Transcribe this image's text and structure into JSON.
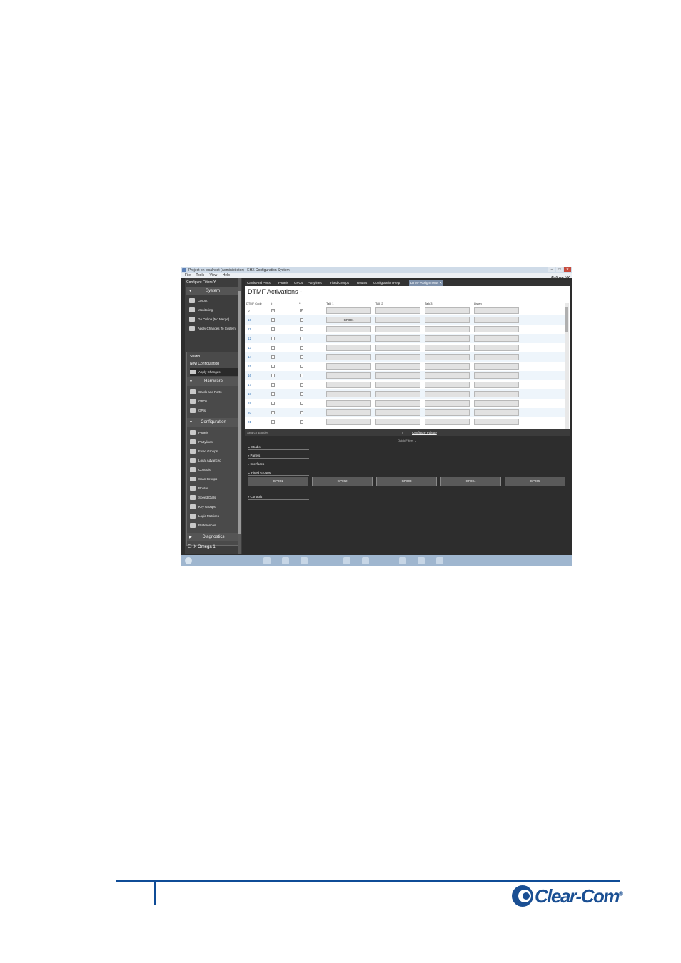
{
  "window": {
    "title": "Project on localhost (Administrator) - EHX Configuration System",
    "menu": [
      "File",
      "Tools",
      "View",
      "Help"
    ],
    "brand": "Eclipse HX",
    "controls": [
      "–",
      "□",
      "✕"
    ]
  },
  "sidebar": {
    "configure_filters": "Configure Filters",
    "system_header": "System",
    "system_items": [
      "Layout",
      "Monitoring",
      "Go Online (No Merge)",
      "Apply Changes To System"
    ],
    "studio_label": "Studio",
    "new_configuration": "New Configuration",
    "apply_changes": "Apply Changes",
    "hardware_header": "Hardware",
    "hardware_items": [
      "Cards and Ports",
      "GPOs",
      "GPIs"
    ],
    "configuration_header": "Configuration",
    "configuration_items": [
      "Panels",
      "Partylines",
      "Fixed Groups",
      "Local Advanced",
      "Controls",
      "Scan Groups",
      "Routes",
      "Speed Dials",
      "Key Groups",
      "Logic Matrices",
      "Preferences"
    ],
    "diagnostics_header": "Diagnostics",
    "matrix_name": "EHX Omega 1"
  },
  "tabs": [
    "Cards And Ports",
    "Panels",
    "GPOs",
    "Partylines",
    "Fixed Groups",
    "Routes",
    "Configuration Help",
    "DTMF Assignments"
  ],
  "active_tab": "DTMF Assignments",
  "dtmf": {
    "title": "DTMF Activations -",
    "columns": [
      "DTMF Code",
      "#",
      "*",
      "Talk 1",
      "Talk 2",
      "Talk 3",
      "Listen"
    ],
    "rows": [
      {
        "code": "0",
        "hash": true,
        "star": true,
        "talk1": "",
        "talk2": "",
        "talk3": "",
        "listen": ""
      },
      {
        "code": "10",
        "hash": false,
        "star": false,
        "talk1": "GP001",
        "talk2": "",
        "talk3": "",
        "listen": ""
      },
      {
        "code": "11",
        "hash": false,
        "star": false,
        "talk1": "",
        "talk2": "",
        "talk3": "",
        "listen": ""
      },
      {
        "code": "12",
        "hash": false,
        "star": false,
        "talk1": "",
        "talk2": "",
        "talk3": "",
        "listen": ""
      },
      {
        "code": "13",
        "hash": false,
        "star": false,
        "talk1": "",
        "talk2": "",
        "talk3": "",
        "listen": ""
      },
      {
        "code": "14",
        "hash": false,
        "star": false,
        "talk1": "",
        "talk2": "",
        "talk3": "",
        "listen": ""
      },
      {
        "code": "15",
        "hash": false,
        "star": false,
        "talk1": "",
        "talk2": "",
        "talk3": "",
        "listen": ""
      },
      {
        "code": "16",
        "hash": false,
        "star": false,
        "talk1": "",
        "talk2": "",
        "talk3": "",
        "listen": ""
      },
      {
        "code": "17",
        "hash": false,
        "star": false,
        "talk1": "",
        "talk2": "",
        "talk3": "",
        "listen": ""
      },
      {
        "code": "18",
        "hash": false,
        "star": false,
        "talk1": "",
        "talk2": "",
        "talk3": "",
        "listen": ""
      },
      {
        "code": "19",
        "hash": false,
        "star": false,
        "talk1": "",
        "talk2": "",
        "talk3": "",
        "listen": ""
      },
      {
        "code": "20",
        "hash": false,
        "star": false,
        "talk1": "",
        "talk2": "",
        "talk3": "",
        "listen": ""
      },
      {
        "code": "21",
        "hash": false,
        "star": false,
        "talk1": "",
        "talk2": "",
        "talk3": "",
        "listen": ""
      }
    ]
  },
  "palette": {
    "search_placeholder": "Search Entities",
    "configure_palette": "Configure Palette",
    "quick_filters": "Quick Filters",
    "studio": "Studio",
    "groups": [
      "Panels",
      "Interfaces",
      "Fixed Groups"
    ],
    "fixed_groups": [
      "GP001",
      "GP002",
      "GP003",
      "GP004",
      "GP005"
    ],
    "controls": "Controls"
  },
  "logo": {
    "text": "Clear-Com",
    "registered": "®"
  },
  "colors": {
    "accent": "#0f4c97",
    "active_tab": "#7b8ea8",
    "dark_panel": "#2d2d2d"
  }
}
